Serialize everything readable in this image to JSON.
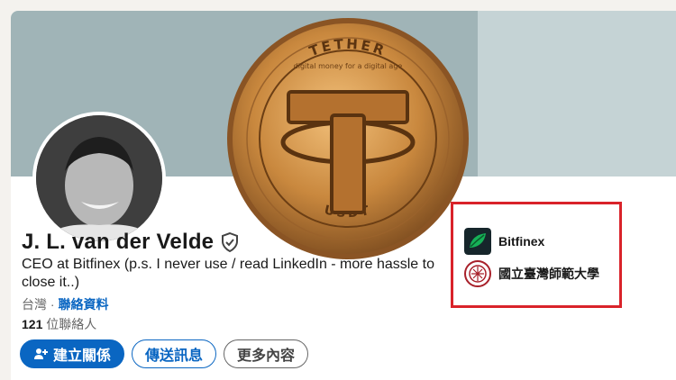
{
  "profile": {
    "name": "J. L. van der Velde",
    "headline": "CEO at Bitfinex (p.s. I never use / read LinkedIn - more hassle to close it..)",
    "location": "台灣",
    "separator": "·",
    "contact_info": "聯絡資料",
    "connections_count": "121",
    "connections_label": "位聯絡人"
  },
  "coin": {
    "top_text": "TETHER",
    "bottom_text": "USDT",
    "ring_text": "digital money for a digital age"
  },
  "actions": {
    "connect": "建立關係",
    "message": "傳送訊息",
    "more": "更多內容"
  },
  "organizations": [
    {
      "name": "Bitfinex",
      "icon": "bitfinex-leaf-icon"
    },
    {
      "name": "國立臺灣師範大學",
      "icon": "university-seal-icon"
    }
  ],
  "colors": {
    "accent": "#0a66c2",
    "highlight_box": "#d9232a",
    "coin_gold": "#c9883e"
  }
}
